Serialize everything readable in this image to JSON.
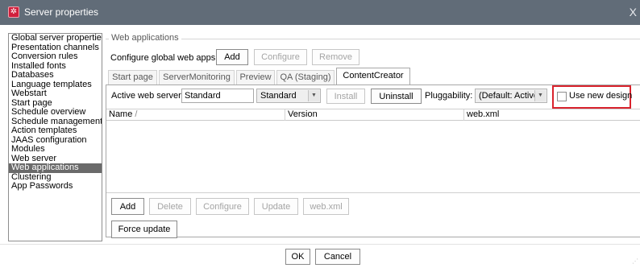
{
  "window": {
    "title": "Server properties",
    "app_icon": "gear-icon",
    "close_glyph": "X"
  },
  "sidebar": {
    "items": [
      {
        "label": "Global server properties"
      },
      {
        "label": "Presentation channels"
      },
      {
        "label": "Conversion rules"
      },
      {
        "label": "Installed fonts"
      },
      {
        "label": "Databases"
      },
      {
        "label": "Language templates"
      },
      {
        "label": "Webstart"
      },
      {
        "label": "Start page"
      },
      {
        "label": "Schedule overview"
      },
      {
        "label": "Schedule management"
      },
      {
        "label": "Action templates"
      },
      {
        "label": "JAAS configuration"
      },
      {
        "label": "Modules"
      },
      {
        "label": "Web server"
      },
      {
        "label": "Web applications"
      },
      {
        "label": "Clustering"
      },
      {
        "label": "App Passwords"
      }
    ],
    "selected": "Web applications"
  },
  "web_apps": {
    "group_title": "Web applications",
    "configure_label": "Configure global web apps:",
    "add": "Add",
    "configure": "Configure",
    "remove": "Remove"
  },
  "tabs": [
    {
      "label": "Start page"
    },
    {
      "label": "ServerMonitoring"
    },
    {
      "label": "Preview"
    },
    {
      "label": "QA (Staging)"
    },
    {
      "label": "ContentCreator"
    }
  ],
  "active_tab": "ContentCreator",
  "content": {
    "active_server_label": "Active web server:",
    "active_server_value": "Standard",
    "server_type": "Standard",
    "install": "Install",
    "uninstall": "Uninstall",
    "pluggability_label": "Pluggability:",
    "pluggability_value": "(Default: Active)",
    "use_new_design_label": "Use new design",
    "use_new_design_checked": false,
    "highlight_color": "#d9232d"
  },
  "table": {
    "columns": [
      {
        "label": "Name",
        "sort_glyph": "/"
      },
      {
        "label": "Version"
      },
      {
        "label": "web.xml"
      }
    ],
    "rows": []
  },
  "table_buttons": {
    "add": "Add",
    "delete": "Delete",
    "configure": "Configure",
    "update": "Update",
    "webxml": "web.xml"
  },
  "force_update": "Force update",
  "dialog": {
    "ok": "OK",
    "cancel": "Cancel"
  }
}
